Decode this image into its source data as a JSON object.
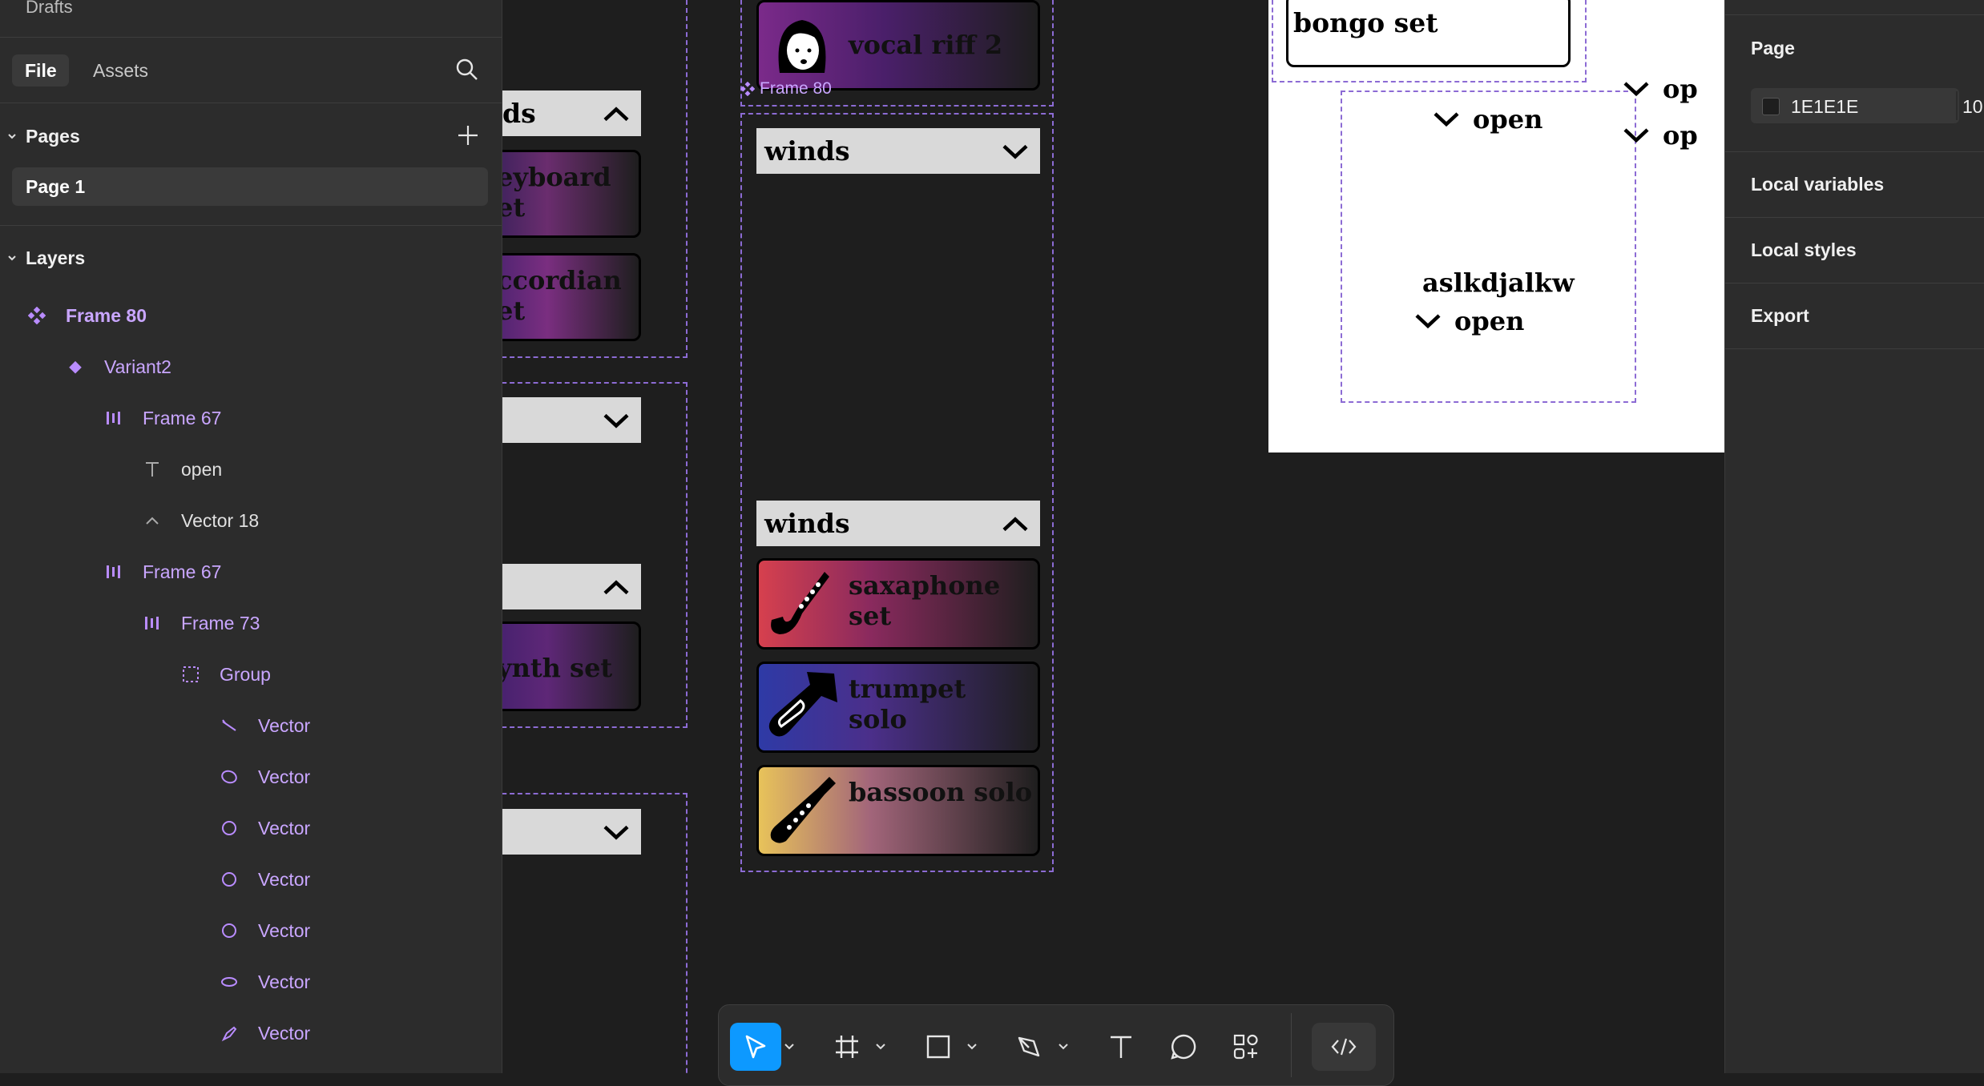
{
  "left_panel": {
    "drafts_label": "Drafts",
    "tabs": [
      {
        "label": "File"
      },
      {
        "label": "Assets"
      }
    ],
    "pages_header": "Pages",
    "pages": [
      {
        "label": "Page 1"
      }
    ],
    "layers_header": "Layers",
    "layers": [
      {
        "label": "Frame 80",
        "icon": "component-icon"
      },
      {
        "label": "Variant2",
        "icon": "variant-icon"
      },
      {
        "label": "Frame 67",
        "icon": "auto-layout-icon"
      },
      {
        "label": "open",
        "icon": "text-icon"
      },
      {
        "label": "Vector 18",
        "icon": "vector-icon"
      },
      {
        "label": "Frame 67",
        "icon": "auto-layout-icon"
      },
      {
        "label": "Frame 73",
        "icon": "auto-layout-icon"
      },
      {
        "label": "Group",
        "icon": "group-icon"
      },
      {
        "label": "Vector",
        "icon": "line-icon"
      },
      {
        "label": "Vector",
        "icon": "ellipse-icon"
      },
      {
        "label": "Vector",
        "icon": "ellipse-icon"
      },
      {
        "label": "Vector",
        "icon": "ellipse-icon"
      },
      {
        "label": "Vector",
        "icon": "ellipse-icon"
      },
      {
        "label": "Vector",
        "icon": "ellipse-icon"
      },
      {
        "label": "Vector",
        "icon": "pen-icon"
      }
    ]
  },
  "canvas": {
    "col1": {
      "header_top": "ds",
      "card1": "eyboard\net",
      "card2": "ccordian\net",
      "card3": "ynth set"
    },
    "col2": {
      "vocal_card": "vocal riff 2",
      "frame_label": "Frame 80",
      "winds_collapsed": "winds",
      "winds_expanded": "winds",
      "cards": [
        {
          "label": "saxaphone set"
        },
        {
          "label": "trumpet solo"
        },
        {
          "label": "bassoon solo"
        }
      ]
    },
    "white_frame": {
      "bongo": "bongo set",
      "open_1": "open",
      "random_text": "aslkdjalkw",
      "open_2": "open",
      "side_open_1": "op",
      "side_open_2": "op"
    }
  },
  "right_panel": {
    "page_header": "Page",
    "bg_color_value": "1E1E1E",
    "bg_opacity_partial": "10",
    "local_variables": "Local variables",
    "local_styles": "Local styles",
    "export": "Export"
  },
  "colors": {
    "accent": "#0d99ff",
    "component_purple": "#c9a6ff",
    "canvas_bg": "#1e1e1e"
  }
}
